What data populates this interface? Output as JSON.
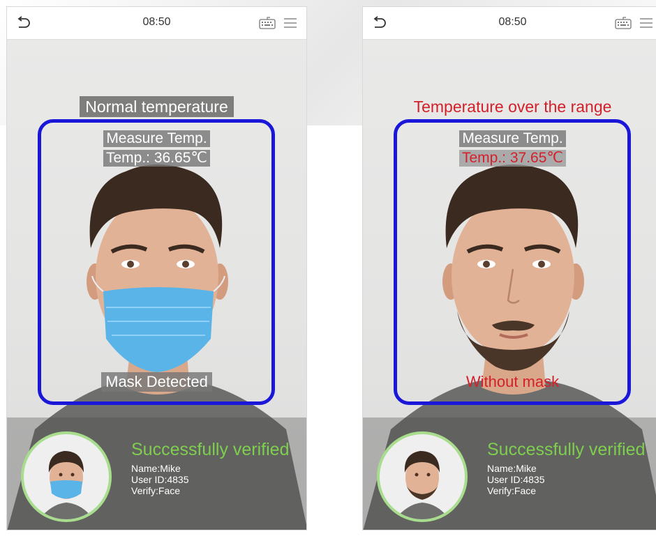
{
  "screens": [
    {
      "status_bar": {
        "time": "08:50",
        "back_icon": "back-arrow-icon",
        "keyboard_icon": "keyboard-icon",
        "menu_icon": "menu-icon"
      },
      "temperature_status": "Normal temperature",
      "measure_title": "Measure Temp.",
      "temperature_reading": "Temp.: 36.65℃",
      "mask_status": "Mask Detected",
      "verification": {
        "result": "Successfully verified",
        "name": "Name:Mike",
        "user_id": "User ID:4835",
        "verify_mode": "Verify:Face"
      }
    },
    {
      "status_bar": {
        "time": "08:50",
        "back_icon": "back-arrow-icon",
        "keyboard_icon": "keyboard-icon",
        "menu_icon": "menu-icon"
      },
      "temperature_status": "Temperature over the range",
      "measure_title": "Measure Temp.",
      "temperature_reading": "Temp.: 37.65℃",
      "mask_status": "Without mask",
      "verification": {
        "result": "Successfully verified",
        "name": "Name:Mike",
        "user_id": "User ID:4835",
        "verify_mode": "Verify:Face"
      }
    }
  ],
  "colors": {
    "face_box": "#1a17d9",
    "alert_text": "#d4202a",
    "success_text": "#7fcf4f",
    "avatar_ring": "#a9dd8e",
    "mask": "#5bb4e8"
  }
}
